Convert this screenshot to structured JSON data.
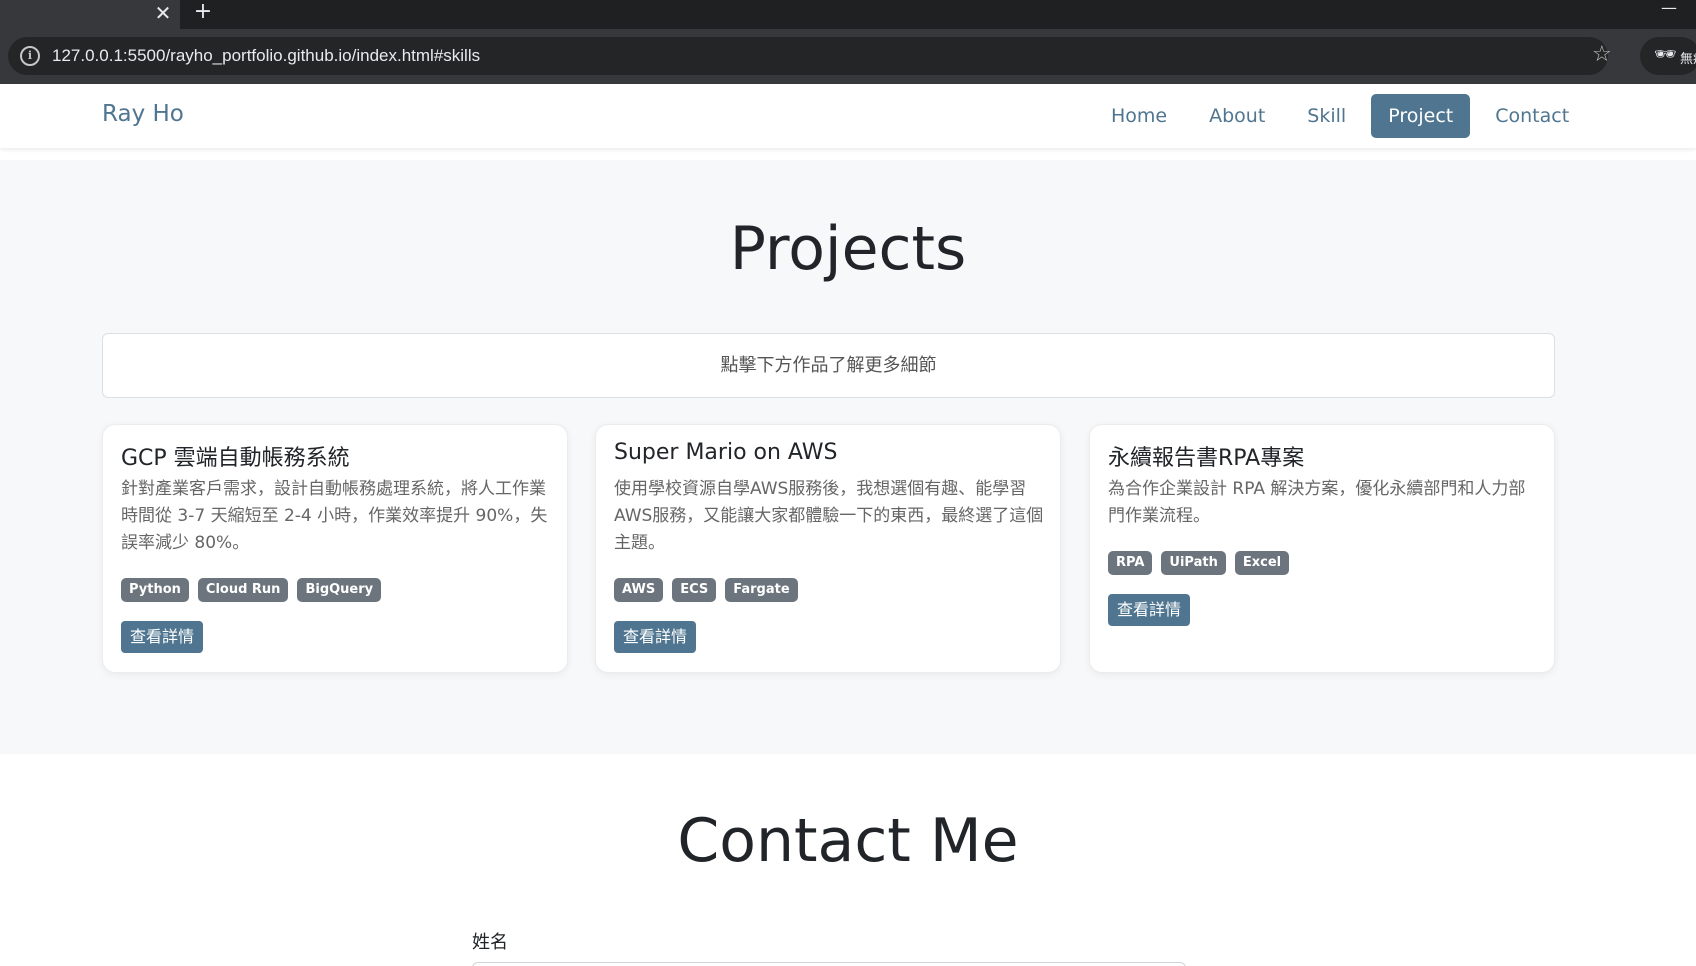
{
  "browser": {
    "tab_close": "✕",
    "new_tab": "+",
    "minimize": "—",
    "url": "127.0.0.1:5500/rayho_portfolio.github.io/index.html#skills",
    "profile_label": "無痕",
    "icons": {
      "site_info": "info-circle-icon",
      "bookmark": "star-icon",
      "profile": "incognito-icon"
    }
  },
  "navbar": {
    "brand": "Ray Ho",
    "links": [
      {
        "label": "Home",
        "active": false
      },
      {
        "label": "About",
        "active": false
      },
      {
        "label": "Skill",
        "active": false
      },
      {
        "label": "Project",
        "active": true
      },
      {
        "label": "Contact",
        "active": false
      }
    ]
  },
  "projects": {
    "title": "Projects",
    "hint": "點擊下方作品了解更多細節",
    "cards": [
      {
        "title": "GCP 雲端自動帳務系統",
        "description": "針對產業客戶需求，設計自動帳務處理系統，將人工作業時間從 3-7 天縮短至 2-4 小時，作業效率提升 90%，失誤率減少 80%。",
        "tags": [
          "Python",
          "Cloud Run",
          "BigQuery"
        ],
        "button": "查看詳情"
      },
      {
        "title": "Super Mario on AWS",
        "description": "使用學校資源自學AWS服務後，我想選個有趣、能學習AWS服務，又能讓大家都體驗一下的東西，最終選了這個主題。",
        "tags": [
          "AWS",
          "ECS",
          "Fargate"
        ],
        "button": "查看詳情"
      },
      {
        "title": "永續報告書RPA專案",
        "description": "為合作企業設計 RPA 解決方案，優化永續部門和人力部門作業流程。",
        "tags": [
          "RPA",
          "UiPath",
          "Excel"
        ],
        "button": "查看詳情"
      }
    ]
  },
  "contact": {
    "title": "Contact Me",
    "name_label": "姓名"
  },
  "colors": {
    "accent": "#4f7590",
    "tag_bg": "#6c757d",
    "section_bg": "#f7f8fa"
  }
}
